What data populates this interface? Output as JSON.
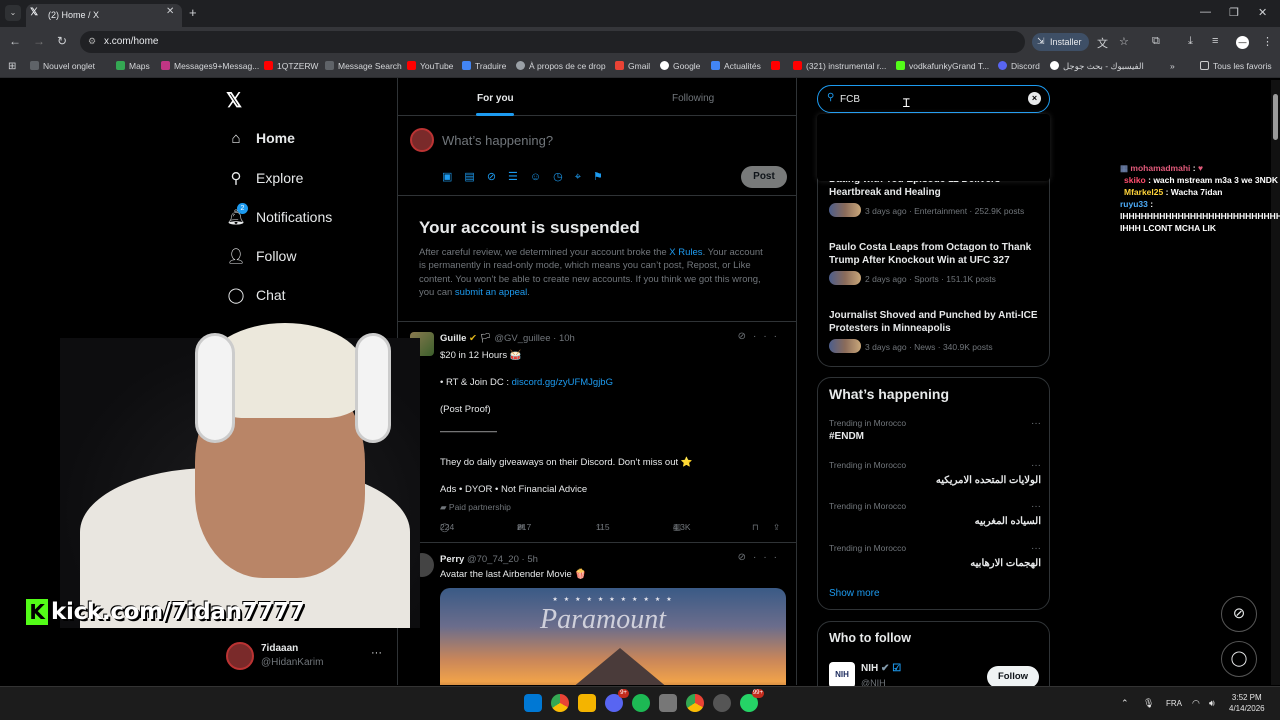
{
  "browser": {
    "tab_title": "(2) Home / X",
    "url": "x.com/home",
    "install_label": "Installer",
    "bookmarks": [
      "Nouvel onglet",
      "Maps",
      "Messages9+Messag...",
      "1QTZERW",
      "Message Search",
      "YouTube",
      "Traduire",
      "À propos de ce drop",
      "Gmail",
      "Google",
      "Actualités",
      "",
      "(321) instrumental r...",
      "vodkafunkyGrand T...",
      "Discord",
      "الفيسبوك - بحث جوجل"
    ],
    "all_bookmarks": "Tous les favoris"
  },
  "nav": {
    "items": [
      {
        "label": "Home",
        "icon": "home-icon",
        "bold": true
      },
      {
        "label": "Explore",
        "icon": "search-icon"
      },
      {
        "label": "Notifications",
        "icon": "bell-icon",
        "badge": "2"
      },
      {
        "label": "Follow",
        "icon": "follow-icon"
      },
      {
        "label": "Chat",
        "icon": "chat-icon"
      }
    ],
    "profile": {
      "name": "7idaaan",
      "handle": "@HidanKarim"
    }
  },
  "timeline": {
    "tab_for_you": "For you",
    "tab_following": "Following",
    "compose_placeholder": "What’s happening?",
    "post_button": "Post",
    "suspended": {
      "title": "Your account is suspended",
      "text_1": "After careful review, we determined your account broke the ",
      "link_rules": "X Rules",
      "text_2": ". Your account is permanently in read-only mode, which means you can’t post, Repost, or Like content. You won’t be able to create new accounts. If you think we got this wrong, you can ",
      "link_appeal": "submit an appeal",
      "text_3": "."
    },
    "tweet1": {
      "name": "Guille",
      "handle": "@GV_guillee",
      "time": "10h",
      "line1": "$20 in 12 Hours 🥁",
      "line2_prefix": "• RT & Join DC : ",
      "line2_link": "discord.gg/zyUFMJgjbG",
      "line3": "(Post Proof)",
      "line4": "——————",
      "line5": "They do daily giveaways on their Discord. Don’t miss out ⭐",
      "line6": "Ads • DYOR • Not Financial Advice",
      "paid": "Paid partnership",
      "replies": "224",
      "reposts": "217",
      "likes": "115",
      "views": "4.3K"
    },
    "tweet2": {
      "name": "Perry",
      "handle": "@70_74_20",
      "time": "5h",
      "text": "Avatar the last Airbender Movie 🍿",
      "image_text": "Paramount"
    }
  },
  "search": {
    "value": "FCB"
  },
  "news": [
    {
      "title": "Dating with You Episode 11 Delivers Heartbreak and Healing",
      "meta": "3 days ago · Entertainment · 252.9K posts"
    },
    {
      "title": "Paulo Costa Leaps from Octagon to Thank Trump After Knockout Win at UFC 327",
      "meta": "2 days ago · Sports · 151.1K posts"
    },
    {
      "title": "Journalist Shoved and Punched by Anti-ICE Protesters in Minneapolis",
      "meta": "3 days ago · News · 340.9K posts"
    }
  ],
  "happening": {
    "title": "What’s happening",
    "trends": [
      {
        "label": "Trending in Morocco",
        "name": "#ENDM",
        "rtl": false
      },
      {
        "label": "Trending in Morocco",
        "name": "الولايات المتحده الامريكيه",
        "rtl": true
      },
      {
        "label": "Trending in Morocco",
        "name": "السياده المغربيه",
        "rtl": true
      },
      {
        "label": "Trending in Morocco",
        "name": "الهجمات الارهابيه",
        "rtl": true
      }
    ],
    "show_more": "Show more"
  },
  "who_to_follow": {
    "title": "Who to follow",
    "name": "NIH",
    "handle": "@NIH",
    "follow_label": "Follow",
    "avatar_text": "NIH"
  },
  "stream_chat": [
    {
      "user": "mohamadmahi",
      "msg": "",
      "color": "#e05a7a"
    },
    {
      "user": "skiko",
      "msg": "wach mstream m3a 3 we 3NDK 1",
      "color": "#ff4d6d"
    },
    {
      "user": "Mfarkel25",
      "msg": "Wacha 7idan",
      "color": "#ffd43b"
    },
    {
      "user": "ruyu33",
      "msg": "",
      "color": "#4dabf7"
    },
    {
      "user": "",
      "msg": "IHHHHHHHHHHHHHHHHHHHHHHHHHH",
      "color": "#ffffff"
    },
    {
      "user": "",
      "msg": "IHHH LCONT MCHA LIK",
      "color": "#ffffff"
    }
  ],
  "overlay": {
    "kick_text": "kick.com/7idan7777"
  },
  "taskbar": {
    "lang": "FRA",
    "time": "3:52 PM",
    "date": "4/14/2026",
    "badge_discord": "9+",
    "badge_whatsapp": "99+"
  },
  "colors": {
    "accent": "#1d9bf0",
    "background": "#000000",
    "border": "#2f3336",
    "muted": "#71767b",
    "kick_green": "#53fc18"
  }
}
